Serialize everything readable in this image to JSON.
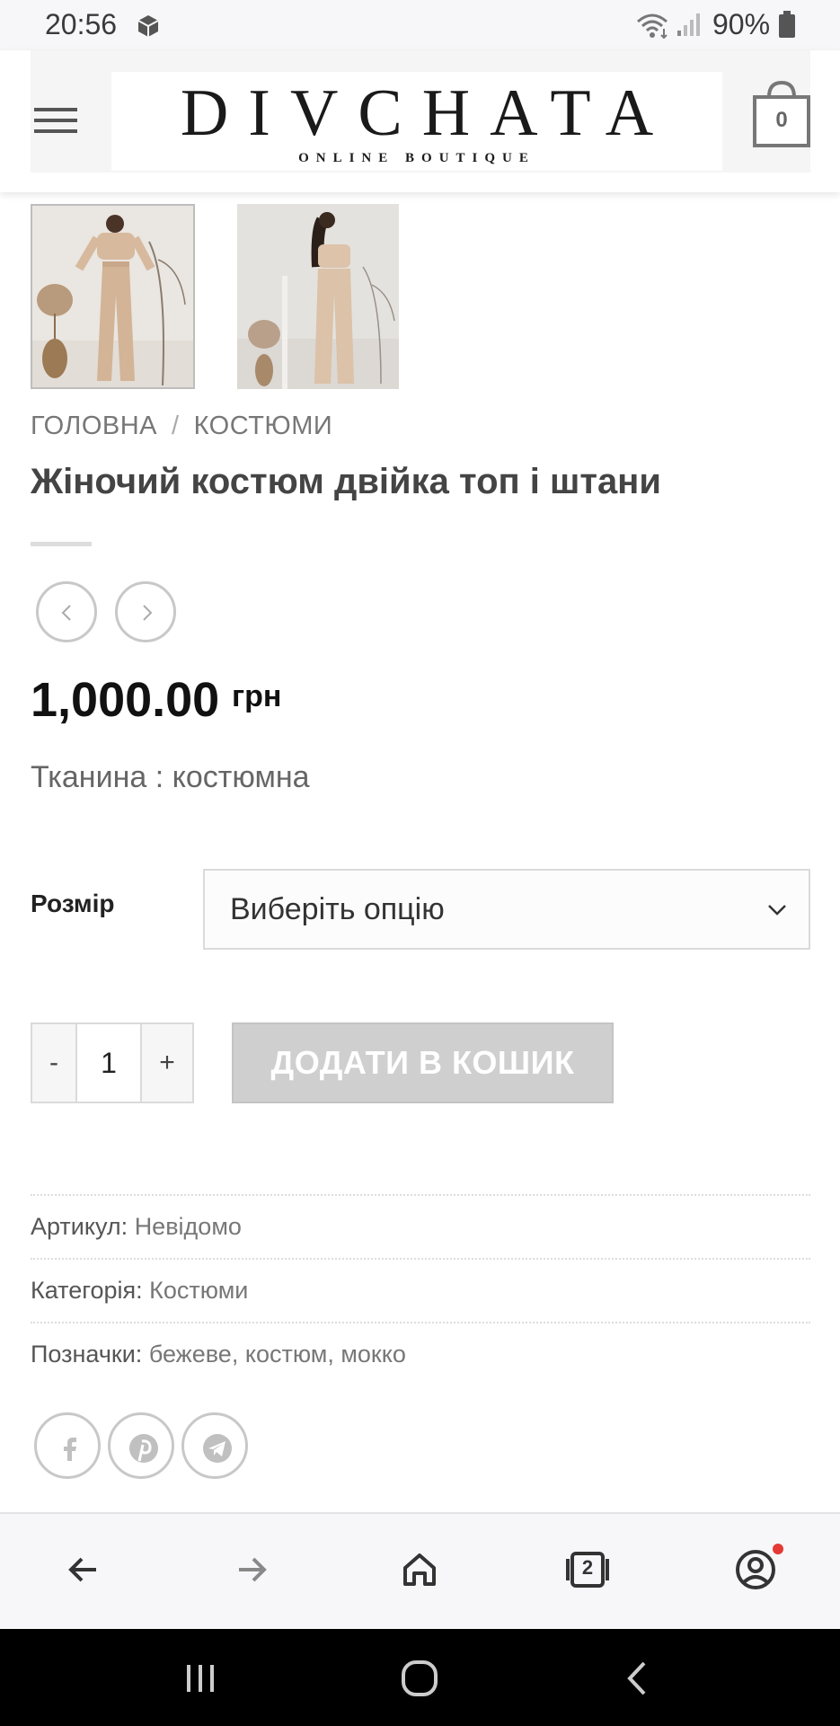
{
  "status_bar": {
    "time": "20:56",
    "battery_percent": "90%",
    "icons": [
      "cube-icon",
      "wifi-icon",
      "signal-icon",
      "battery-icon"
    ]
  },
  "header": {
    "logo_title": "DIVCHATA",
    "logo_subtitle": "ONLINE BOUTIQUE",
    "cart_count": "0",
    "icons": [
      "menu-icon",
      "cart-icon"
    ]
  },
  "gallery": {
    "thumbnails": [
      "product-photo-front",
      "product-photo-back"
    ]
  },
  "breadcrumb": {
    "home": "ГОЛОВНА",
    "separator": "/",
    "category": "КОСТЮМИ"
  },
  "product": {
    "title": "Жіночий костюм двійка топ і штани",
    "price": "1,000.00",
    "currency": "грн",
    "fabric": "Тканина : костюмна"
  },
  "variations": {
    "size_label": "Розмір",
    "size_select_value": "Виберіть опцію"
  },
  "cart_form": {
    "minus": "-",
    "quantity": "1",
    "plus": "+",
    "add_to_cart": "ДОДАТИ В КОШИК"
  },
  "meta": {
    "sku_label": "Артикул:",
    "sku_value": "Невідомо",
    "category_label": "Категорія:",
    "category_value": "Костюми",
    "tags_label": "Позначки:",
    "tags_value": "бежеве, костюм, мокко"
  },
  "share_icons": [
    "facebook-icon",
    "pinterest-icon",
    "telegram-icon"
  ],
  "browser_toolbar": {
    "tabs_count": "2",
    "icons": [
      "back-arrow-icon",
      "forward-arrow-icon",
      "home-icon",
      "tabs-icon",
      "account-icon"
    ]
  },
  "system_nav": {
    "icons": [
      "recent-apps-icon",
      "home-circle-icon",
      "back-chevron-icon"
    ]
  },
  "colors": {
    "button_disabled": "#cfcfcf",
    "text_dark": "#111111",
    "notification_dot": "#e53935"
  }
}
